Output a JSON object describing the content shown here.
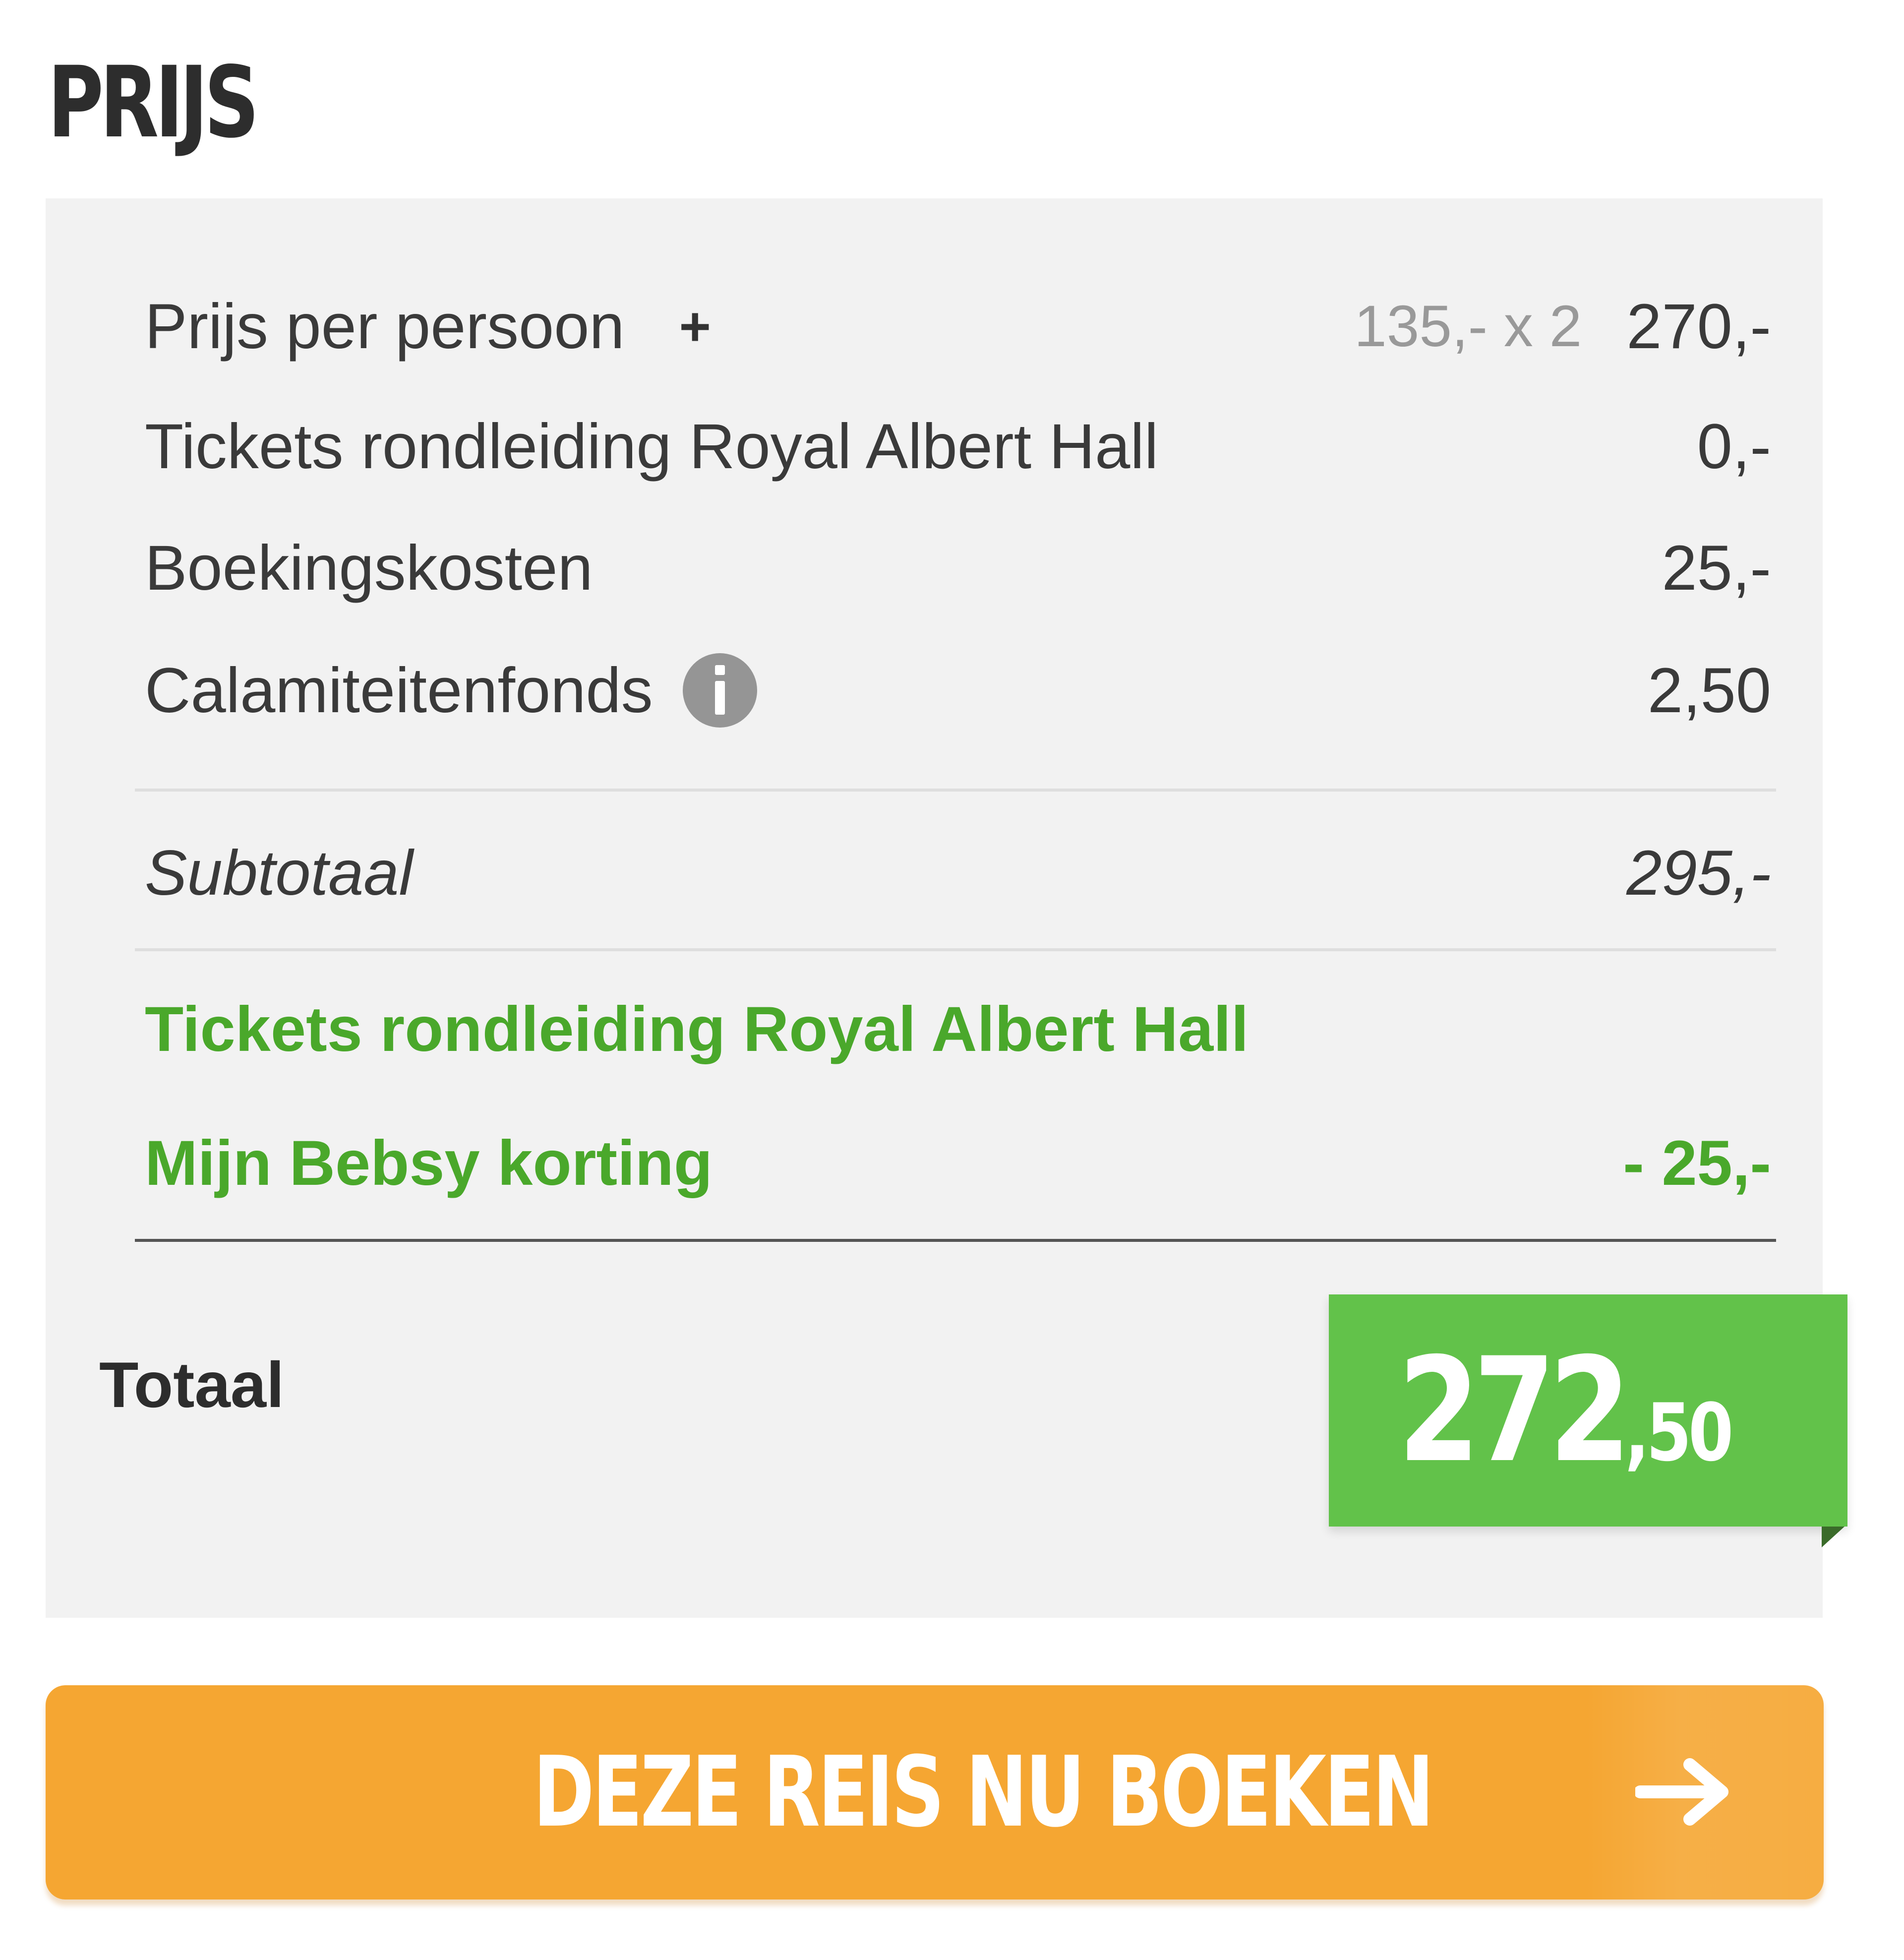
{
  "header": {
    "title": "PRIJS"
  },
  "price_table": {
    "rows": [
      {
        "label": "Prijs per persoon",
        "plus_icon": "+",
        "calculation": "135,- x 2",
        "value": "270,-"
      },
      {
        "label": "Tickets rondleiding Royal Albert Hall",
        "value": "0,-"
      },
      {
        "label": "Boekingskosten",
        "value": "25,-"
      },
      {
        "label": "Calamiteitenfonds",
        "info_icon": "info-icon",
        "value": "2,50"
      }
    ],
    "subtotal": {
      "label": "Subtotaal",
      "value": "295,-"
    },
    "discounts": [
      {
        "label": "Tickets rondleiding Royal Albert Hall",
        "value": ""
      },
      {
        "label": "Mijn Bebsy korting",
        "value": "- 25,-"
      }
    ],
    "total": {
      "label": "Totaal",
      "amount_main": "272",
      "amount_fraction": ",50"
    }
  },
  "cta": {
    "label": "DEZE REIS NU BOEKEN",
    "icon": "arrow-right-icon"
  },
  "colors": {
    "panel_bg": "#f2f2f2",
    "discount_green": "#4aa82b",
    "total_badge_green": "#62c24a",
    "cta_orange": "#f5a632"
  }
}
